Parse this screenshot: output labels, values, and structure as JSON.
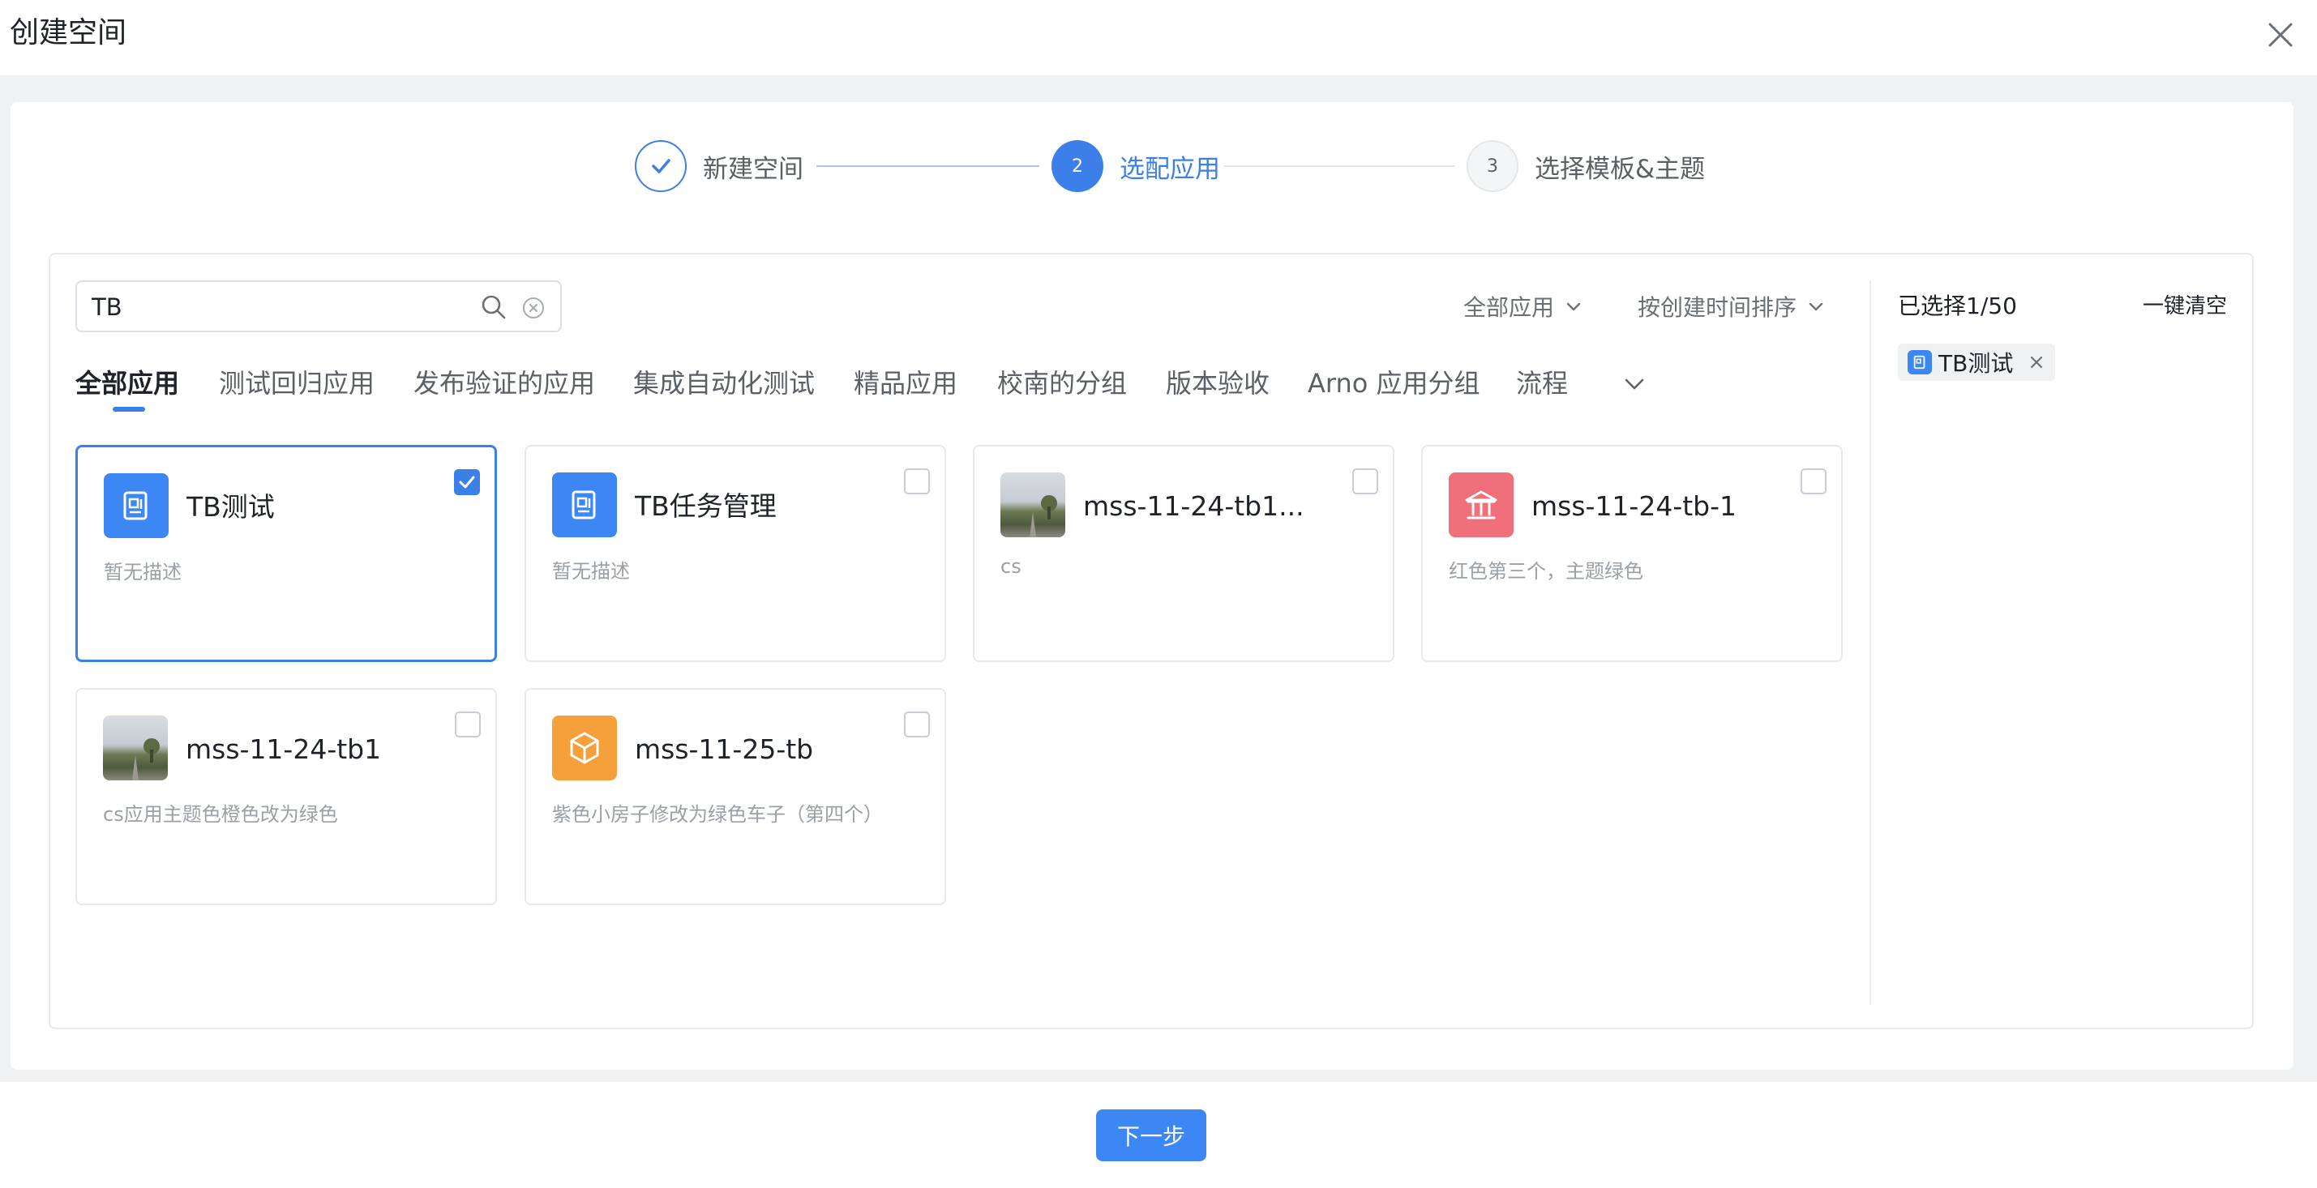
{
  "dialog": {
    "title": "创建空间"
  },
  "steps": [
    {
      "number": "1",
      "label": "新建空间",
      "state": "done"
    },
    {
      "number": "2",
      "label": "选配应用",
      "state": "active"
    },
    {
      "number": "3",
      "label": "选择模板&主题",
      "state": "pending"
    }
  ],
  "search": {
    "value": "TB",
    "placeholder": ""
  },
  "filters": {
    "scope": "全部应用",
    "sort": "按创建时间排序"
  },
  "tabs": [
    "全部应用",
    "测试回归应用",
    "发布验证的应用",
    "集成自动化测试",
    "精品应用",
    "校南的分组",
    "版本验收",
    "Arno 应用分组",
    "流程"
  ],
  "apps": [
    {
      "title": "TB测试",
      "desc": "暂无描述",
      "icon": "document-icon",
      "selected": true
    },
    {
      "title": "TB任务管理",
      "desc": "暂无描述",
      "icon": "document-icon",
      "selected": false
    },
    {
      "title": "mss-11-24-tb1...",
      "desc": "cs",
      "icon": "photo-thumbnail",
      "selected": false
    },
    {
      "title": "mss-11-24-tb-1",
      "desc": "红色第三个，主题绿色",
      "icon": "bank-icon",
      "selected": false
    },
    {
      "title": "mss-11-24-tb1",
      "desc": "cs应用主题色橙色改为绿色",
      "icon": "photo-thumbnail",
      "selected": false
    },
    {
      "title": "mss-11-25-tb",
      "desc": "紫色小房子修改为绿色车子（第四个）",
      "icon": "cube-icon",
      "selected": false
    }
  ],
  "selection": {
    "count_label": "已选择1/50",
    "clear_label": "一键清空",
    "chips": [
      {
        "label": "TB测试"
      }
    ]
  },
  "footer": {
    "next_label": "下一步"
  },
  "colors": {
    "accent": "#3d7fe9",
    "red": "#ef6f7a",
    "orange": "#f5a03a"
  }
}
